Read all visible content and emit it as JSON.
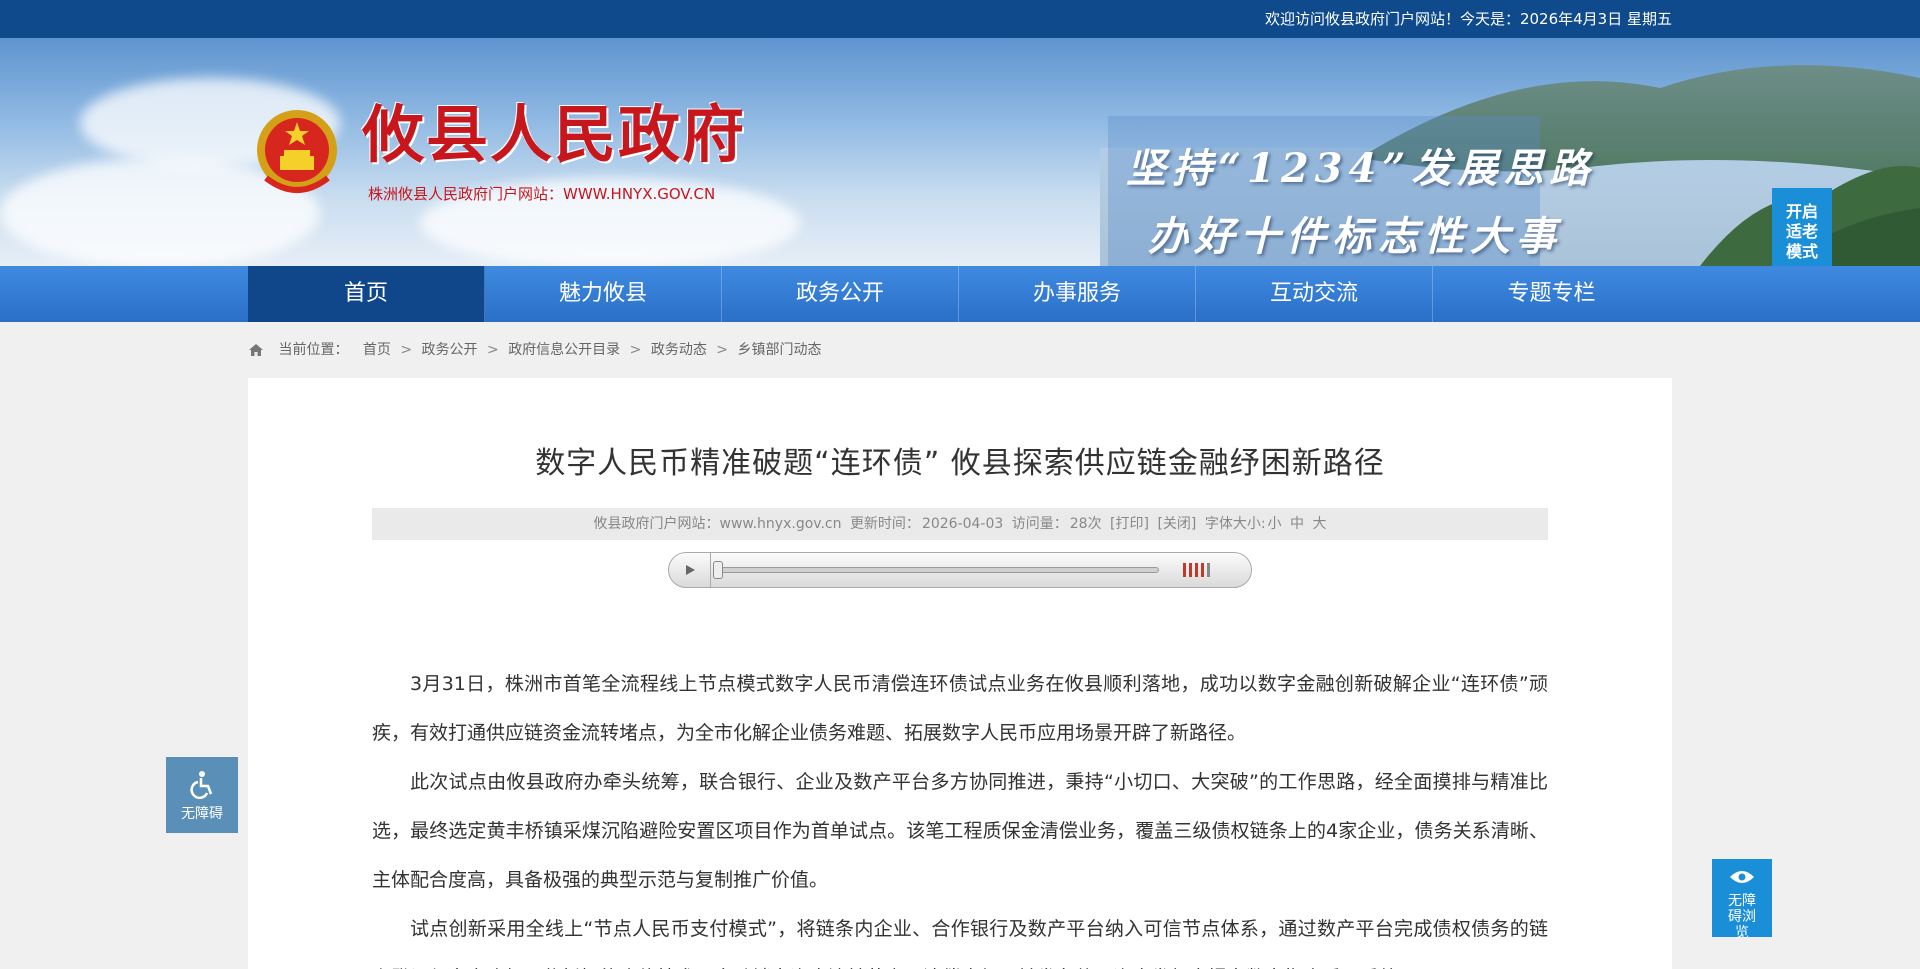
{
  "topbar": {
    "welcome": "欢迎访问攸县政府门户网站！今天是：2026年4月3日 星期五"
  },
  "header": {
    "site_title": "攸县人民政府",
    "site_subtitle": "株洲攸县人民政府门户网站：WWW.HNYX.GOV.CN",
    "slogan_line1": "坚持“1234”发展思路",
    "slogan_line2": "办好十件标志性大事",
    "elder_mode_label": "开启适老模式",
    "emblem_icon": "national-emblem-icon"
  },
  "nav": {
    "items": [
      {
        "label": "首页",
        "active": true
      },
      {
        "label": "魅力攸县",
        "active": false
      },
      {
        "label": "政务公开",
        "active": false
      },
      {
        "label": "办事服务",
        "active": false
      },
      {
        "label": "互动交流",
        "active": false
      },
      {
        "label": "专题专栏",
        "active": false
      }
    ]
  },
  "breadcrumb": {
    "prefix": "当前位置：",
    "items": [
      "首页",
      "政务公开",
      "政府信息公开目录",
      "政务动态",
      "乡镇部门动态"
    ],
    "separator": ">"
  },
  "article": {
    "title": "数字人民币精准破题“连环债” 攸县探索供应链金融纾困新路径",
    "meta": {
      "source": "攸县政府门户网站：www.hnyx.gov.cn",
      "updated_label": "更新时间：",
      "updated": "2026-04-03",
      "views_label": "访问量：",
      "views": "28次",
      "print": "[打印]",
      "close": "[关闭]",
      "font_label": "字体大小:",
      "font_small": "小",
      "font_medium": "中",
      "font_large": "大"
    },
    "player": {
      "progress": 0,
      "volume_bars_on": 4,
      "volume_bars_total": 5
    },
    "paragraphs": [
      "3月31日，株洲市首笔全流程线上节点模式数字人民币清偿连环债试点业务在攸县顺利落地，成功以数字金融创新破解企业“连环债”顽疾，有效打通供应链资金流转堵点，为全市化解企业债务难题、拓展数字人民币应用场景开辟了新路径。",
      "此次试点由攸县政府办牵头统筹，联合银行、企业及数产平台多方协同推进，秉持“小切口、大突破”的工作思路，经全面摸排与精准比选，最终选定黄丰桥镇采煤沉陷避险安置区项目作为首单试点。该笔工程质保金清偿业务，覆盖三级债权链条上的4家企业，债务关系清晰、主体配合度高，具备极强的典型示范与复制推广价值。",
      "试点创新采用全线上“节点人民币支付模式”，将链条内企业、合作银行及数产平台纳入可信节点体系，通过数产平台完成债权债务的链上登记与多方确权，依托智能合约技术，自动锁定资金流转节点、清偿金额及触发条件。资金发起方提交数字指令后，系统即"
    ]
  },
  "accessibility": {
    "left_label": "无障碍",
    "right_label": "无障碍浏览",
    "left_icon": "wheelchair-icon",
    "right_icon": "eye-icon"
  },
  "colors": {
    "topbar": "#0e4a8c",
    "nav": "#2a6fc8",
    "nav_active": "#10478a",
    "title_red": "#c8161d",
    "elder_button": "#1a8fd8"
  }
}
